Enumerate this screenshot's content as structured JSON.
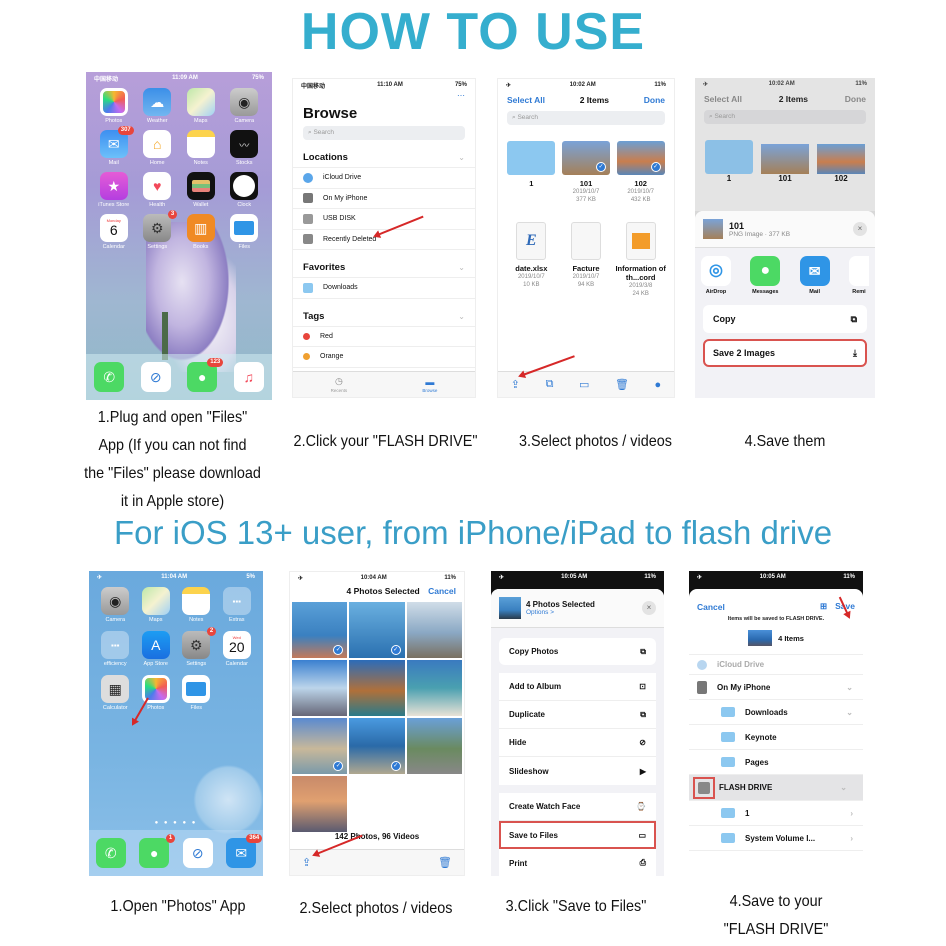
{
  "header": {
    "title": "HOW TO USE",
    "subtitle": "For iOS 13+ user, from iPhone/iPad to flash drive"
  },
  "colors": {
    "title": "#35aece",
    "subtitle": "#3a9ec7",
    "ios_blue": "#2f7ad4",
    "highlight_red": "#d9534f",
    "arrow_red": "#d62828"
  },
  "row1": {
    "captions": [
      [
        "1.Plug and open \"Files\"",
        "App (If you can not find",
        "the \"Files\" please download",
        "it in Apple store)"
      ],
      "2.Click your \"FLASH DRIVE\"",
      "3.Select photos / videos",
      "4.Save them"
    ],
    "screen1": {
      "status": {
        "carrier": "中国移动",
        "time": "11:09 AM",
        "battery": "75%"
      },
      "apps": [
        {
          "label": "Photos",
          "icon": "photos-icon"
        },
        {
          "label": "Weather",
          "icon": "weather-icon"
        },
        {
          "label": "Maps",
          "icon": "maps-icon"
        },
        {
          "label": "Camera",
          "icon": "camera-icon"
        },
        {
          "label": "Mail",
          "icon": "mail-icon",
          "badge": "307"
        },
        {
          "label": "Home",
          "icon": "home-icon"
        },
        {
          "label": "Notes",
          "icon": "notes-icon"
        },
        {
          "label": "Stocks",
          "icon": "stocks-icon"
        },
        {
          "label": "iTunes Store",
          "icon": "itunes-icon"
        },
        {
          "label": "Health",
          "icon": "health-icon"
        },
        {
          "label": "Wallet",
          "icon": "wallet-icon"
        },
        {
          "label": "Clock",
          "icon": "clock-icon"
        },
        {
          "label": "Calendar",
          "icon": "calendar-icon",
          "day": "Monday",
          "date": "6"
        },
        {
          "label": "Settings",
          "icon": "settings-icon",
          "badge": "3"
        },
        {
          "label": "Books",
          "icon": "books-icon"
        },
        {
          "label": "Files",
          "icon": "files-icon"
        }
      ],
      "dock": [
        {
          "icon": "phone-icon"
        },
        {
          "icon": "safari-icon"
        },
        {
          "icon": "messages-icon",
          "badge": "123"
        },
        {
          "icon": "music-icon"
        }
      ]
    },
    "screen2": {
      "status": {
        "carrier": "中国移动",
        "time": "11:10 AM",
        "battery": "75%"
      },
      "title": "Browse",
      "search_placeholder": "Search",
      "sections": [
        {
          "title": "Locations",
          "items": [
            "iCloud Drive",
            "On My iPhone",
            "USB DISK",
            "Recently Deleted"
          ]
        },
        {
          "title": "Favorites",
          "items": [
            "Downloads"
          ]
        },
        {
          "title": "Tags",
          "items": [
            "Red",
            "Orange"
          ]
        }
      ],
      "tabs": [
        "Recents",
        "Browse"
      ]
    },
    "screen3": {
      "status": {
        "time": "10:02 AM",
        "battery": "11%"
      },
      "select_all": "Select All",
      "title": "2 Items",
      "done": "Done",
      "search_placeholder": "Search",
      "files": [
        {
          "name": "1",
          "date": "",
          "size": "",
          "type": "folder"
        },
        {
          "name": "101",
          "date": "2019/10/7",
          "size": "377 KB",
          "type": "image",
          "selected": true
        },
        {
          "name": "102",
          "date": "2019/10/7",
          "size": "432 KB",
          "type": "image",
          "selected": true
        },
        {
          "name": "date.xlsx",
          "date": "2019/10/7",
          "size": "10 KB",
          "type": "doc"
        },
        {
          "name": "Facture",
          "date": "2019/10/7",
          "size": "94 KB",
          "type": "doc"
        },
        {
          "name": "Information of th...cord",
          "date": "2019/3/8",
          "size": "24 KB",
          "type": "doc"
        }
      ]
    },
    "screen4": {
      "status": {
        "time": "10:02 AM",
        "battery": "11%"
      },
      "select_all": "Select All",
      "title": "2 Items",
      "done": "Done",
      "search_placeholder": "Search",
      "files": [
        "1",
        "101",
        "102"
      ],
      "preview_name": "101",
      "preview_meta": "PNG Image · 377 KB",
      "share_targets": [
        "AirDrop",
        "Messages",
        "Mail",
        "Remi"
      ],
      "actions": [
        "Copy",
        "Save 2 Images"
      ]
    }
  },
  "row2": {
    "captions": [
      "1.Open \"Photos\" App",
      "2.Select photos / videos",
      "3.Click \"Save to Files\"",
      [
        "4.Save to your",
        "\"FLASH DRIVE\""
      ]
    ],
    "screen1": {
      "status": {
        "time": "11:04 AM",
        "battery": "5%"
      },
      "apps": [
        {
          "label": "Camera",
          "icon": "camera-icon"
        },
        {
          "label": "Maps",
          "icon": "maps-icon"
        },
        {
          "label": "Notes",
          "icon": "notes-icon"
        },
        {
          "label": "Extras",
          "icon": "folder-extras-icon"
        },
        {
          "label": "efficiency",
          "icon": "folder-efficiency-icon"
        },
        {
          "label": "App Store",
          "icon": "app-store-icon"
        },
        {
          "label": "Settings",
          "icon": "settings-icon",
          "badge": "2"
        },
        {
          "label": "Calendar",
          "icon": "calendar-icon",
          "day": "Wed",
          "date": "20"
        },
        {
          "label": "Calculator",
          "icon": "calculator-icon"
        },
        {
          "label": "Photos",
          "icon": "photos-icon"
        },
        {
          "label": "Files",
          "icon": "files-icon"
        }
      ],
      "dock": [
        {
          "icon": "phone-icon"
        },
        {
          "icon": "messages-icon",
          "badge": "1"
        },
        {
          "icon": "safari-icon"
        },
        {
          "icon": "mail-icon",
          "badge": "364"
        }
      ]
    },
    "screen2": {
      "status": {
        "time": "10:04 AM",
        "battery": "11%"
      },
      "title": "4 Photos Selected",
      "cancel": "Cancel",
      "photos_selected": [
        true,
        true,
        false,
        false,
        false,
        false,
        true,
        true,
        false,
        false
      ],
      "footer": "142 Photos, 96 Videos"
    },
    "screen3": {
      "status": {
        "time": "10:05 AM",
        "battery": "11%"
      },
      "title": "4 Photos Selected",
      "options": "Options >",
      "actions": [
        {
          "label": "Copy Photos",
          "icon": "copy-icon"
        },
        {
          "label": "Add to Album",
          "icon": "add-album-icon"
        },
        {
          "label": "Duplicate",
          "icon": "duplicate-icon"
        },
        {
          "label": "Hide",
          "icon": "hide-icon"
        },
        {
          "label": "Slideshow",
          "icon": "play-icon"
        },
        {
          "label": "Create Watch Face",
          "icon": "watch-icon"
        },
        {
          "label": "Save to Files",
          "icon": "folder-icon",
          "highlighted": true
        },
        {
          "label": "Print",
          "icon": "print-icon"
        }
      ]
    },
    "screen4": {
      "status": {
        "time": "10:05 AM",
        "battery": "11%"
      },
      "cancel": "Cancel",
      "save": "Save",
      "notice": "Items will be saved to FLASH DRIVE.",
      "items_count": "4 Items",
      "locations": [
        {
          "label": "iCloud Drive",
          "level": 0
        },
        {
          "label": "On My iPhone",
          "level": 0,
          "chevron": "down"
        },
        {
          "label": "Downloads",
          "level": 1,
          "chevron": "down"
        },
        {
          "label": "Keynote",
          "level": 1
        },
        {
          "label": "Pages",
          "level": 1
        },
        {
          "label": "FLASH DRIVE",
          "level": 0,
          "chevron": "down",
          "selected": true
        },
        {
          "label": "1",
          "level": 1,
          "chevron": "right"
        },
        {
          "label": "System Volume I...",
          "level": 1,
          "chevron": "right"
        }
      ]
    }
  }
}
